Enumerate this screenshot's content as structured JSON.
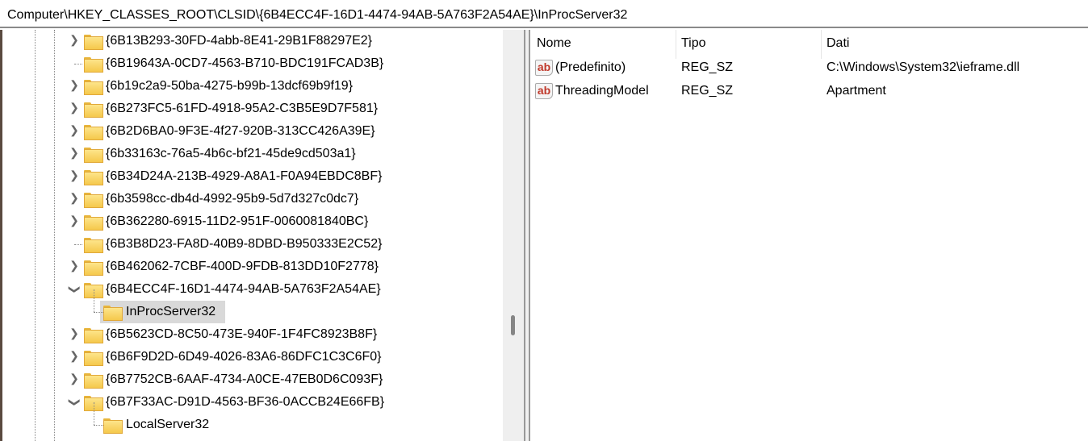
{
  "address": "Computer\\HKEY_CLASSES_ROOT\\CLSID\\{6B4ECC4F-16D1-4474-94AB-5A763F2A54AE}\\InProcServer32",
  "tree": [
    {
      "label": "{6B13B293-30FD-4abb-8E41-29B1F88297E2}",
      "expander": "collapsed",
      "level": 0
    },
    {
      "label": "{6B19643A-0CD7-4563-B710-BDC191FCAD3B}",
      "expander": "none",
      "level": 0
    },
    {
      "label": "{6b19c2a9-50ba-4275-b99b-13dcf69b9f19}",
      "expander": "collapsed",
      "level": 0
    },
    {
      "label": "{6B273FC5-61FD-4918-95A2-C3B5E9D7F581}",
      "expander": "collapsed",
      "level": 0
    },
    {
      "label": "{6B2D6BA0-9F3E-4f27-920B-313CC426A39E}",
      "expander": "collapsed",
      "level": 0
    },
    {
      "label": "{6b33163c-76a5-4b6c-bf21-45de9cd503a1}",
      "expander": "collapsed",
      "level": 0
    },
    {
      "label": "{6B34D24A-213B-4929-A8A1-F0A94EBDC8BF}",
      "expander": "collapsed",
      "level": 0
    },
    {
      "label": "{6b3598cc-db4d-4992-95b9-5d7d327c0dc7}",
      "expander": "collapsed",
      "level": 0
    },
    {
      "label": "{6B362280-6915-11D2-951F-0060081840BC}",
      "expander": "collapsed",
      "level": 0
    },
    {
      "label": "{6B3B8D23-FA8D-40B9-8DBD-B950333E2C52}",
      "expander": "none",
      "level": 0
    },
    {
      "label": "{6B462062-7CBF-400D-9FDB-813DD10F2778}",
      "expander": "collapsed",
      "level": 0
    },
    {
      "label": "{6B4ECC4F-16D1-4474-94AB-5A763F2A54AE}",
      "expander": "expanded",
      "level": 0
    },
    {
      "label": "InProcServer32",
      "expander": "none",
      "level": 1,
      "selected": true
    },
    {
      "label": "{6B5623CD-8C50-473E-940F-1F4FC8923B8F}",
      "expander": "collapsed",
      "level": 0
    },
    {
      "label": "{6B6F9D2D-6D49-4026-83A6-86DFC1C3C6F0}",
      "expander": "collapsed",
      "level": 0
    },
    {
      "label": "{6B7752CB-6AAF-4734-A0CE-47EB0D6C093F}",
      "expander": "collapsed",
      "level": 0
    },
    {
      "label": "{6B7F33AC-D91D-4563-BF36-0ACCB24E66FB}",
      "expander": "expanded",
      "level": 0
    },
    {
      "label": "LocalServer32",
      "expander": "none",
      "level": 1
    }
  ],
  "values": {
    "columns": [
      "Nome",
      "Tipo",
      "Dati"
    ],
    "rows": [
      {
        "name": "(Predefinito)",
        "type": "REG_SZ",
        "data": "C:\\Windows\\System32\\ieframe.dll",
        "icon": "string-value-icon"
      },
      {
        "name": "ThreadingModel",
        "type": "REG_SZ",
        "data": "Apartment",
        "icon": "string-value-icon"
      }
    ],
    "icon_text": "ab"
  }
}
